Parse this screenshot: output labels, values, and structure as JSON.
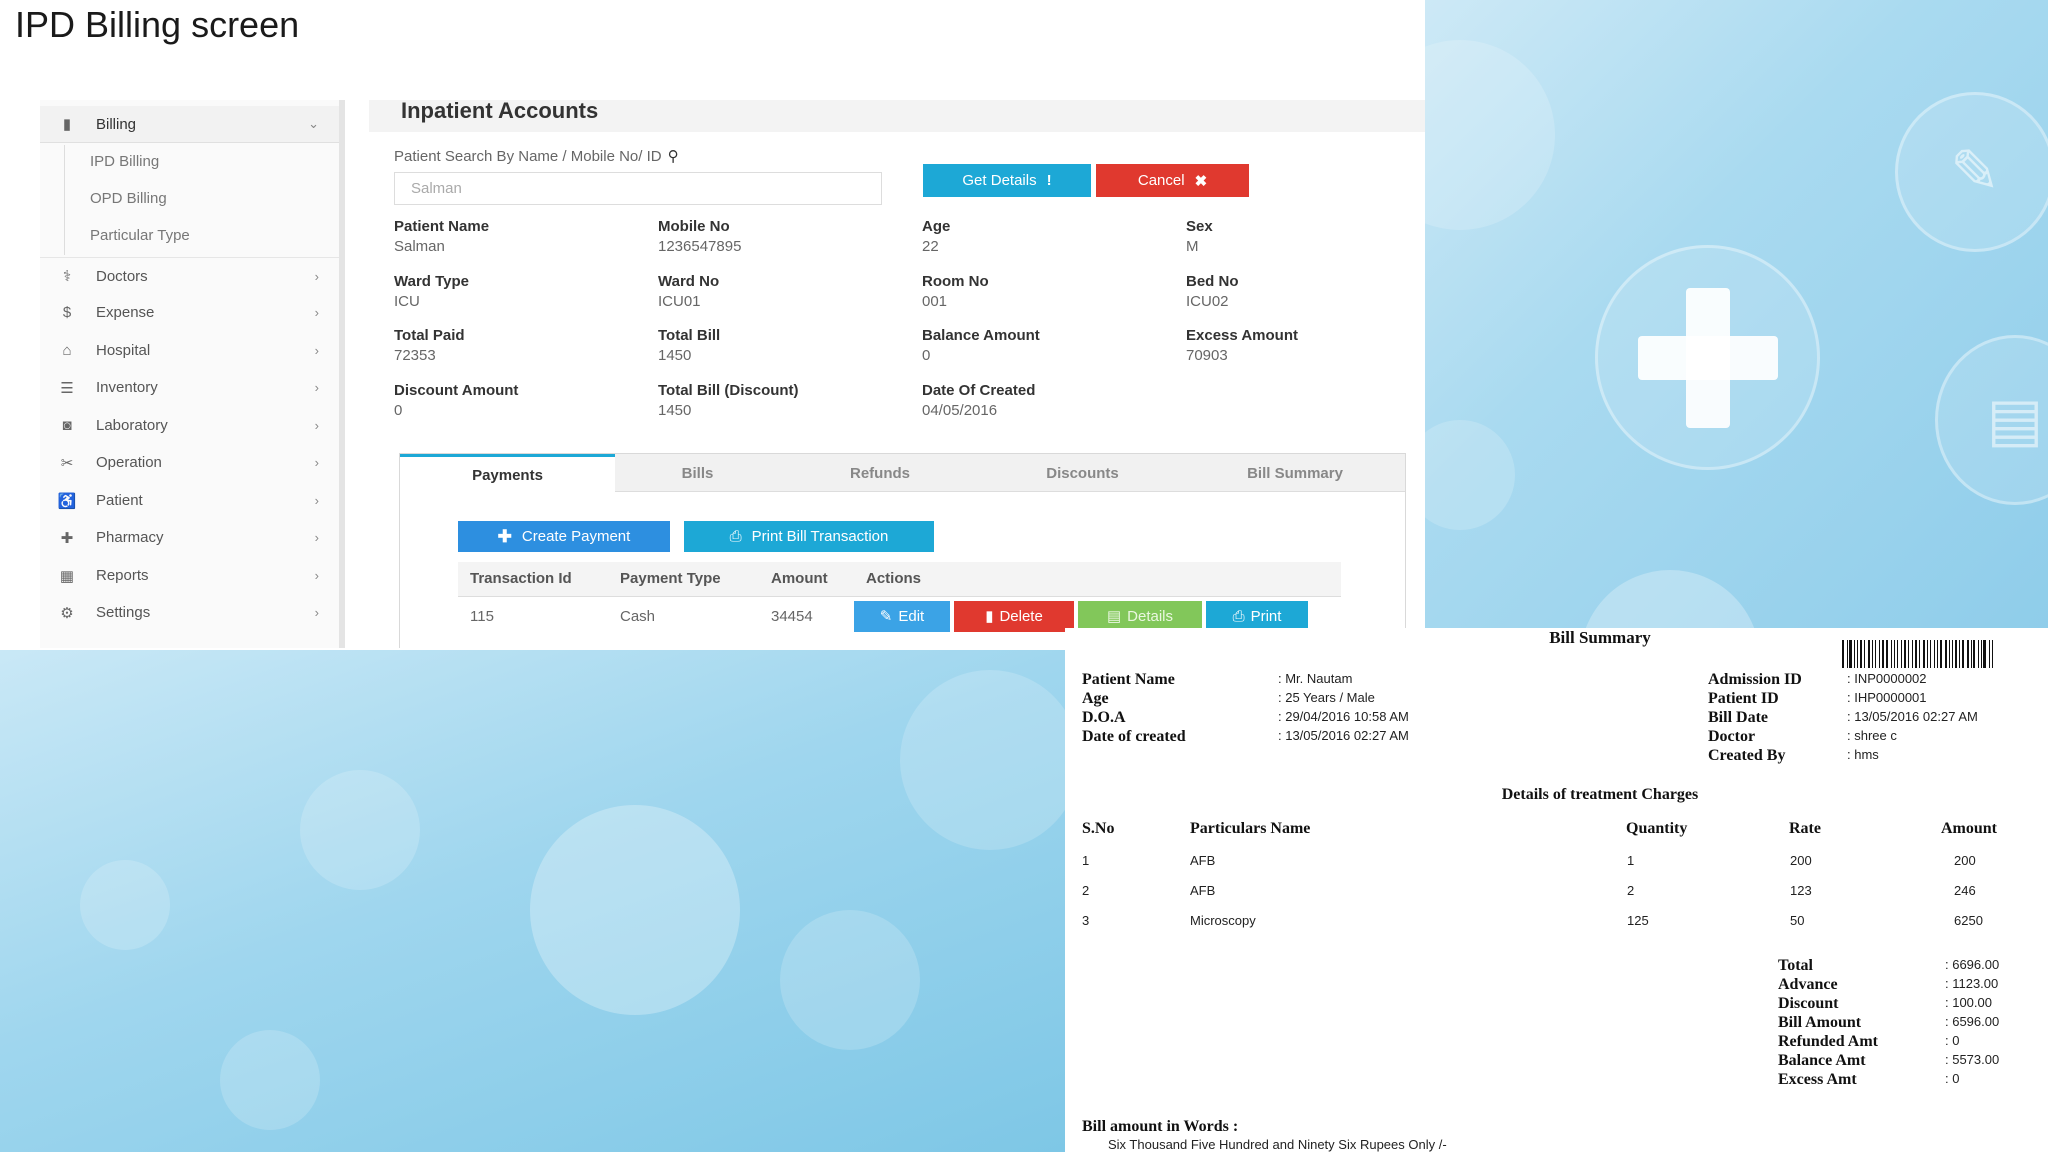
{
  "slide_title": "IPD Billing screen",
  "sidebar": {
    "items": [
      {
        "icon": "billing-icon",
        "label": "Billing"
      },
      {
        "icon": "doctor-icon",
        "label": "Doctors"
      },
      {
        "icon": "dollar-icon",
        "label": "Expense"
      },
      {
        "icon": "hospital-icon",
        "label": "Hospital"
      },
      {
        "icon": "inventory-icon",
        "label": "Inventory"
      },
      {
        "icon": "laboratory-icon",
        "label": "Laboratory"
      },
      {
        "icon": "operation-icon",
        "label": "Operation"
      },
      {
        "icon": "patient-icon",
        "label": "Patient"
      },
      {
        "icon": "plus-icon",
        "label": "Pharmacy"
      },
      {
        "icon": "reports-icon",
        "label": "Reports"
      },
      {
        "icon": "gear-icon",
        "label": "Settings"
      }
    ],
    "billing_sub": [
      "IPD Billing",
      "OPD Billing",
      "Particular Type"
    ]
  },
  "main": {
    "title": "Inpatient Accounts",
    "search_label": "Patient Search By Name / Mobile No/ ID",
    "search_value": "Salman",
    "get_details_label": "Get Details",
    "cancel_label": "Cancel",
    "fields": [
      {
        "label": "Patient Name",
        "value": "Salman"
      },
      {
        "label": "Mobile No",
        "value": "1236547895"
      },
      {
        "label": "Age",
        "value": "22"
      },
      {
        "label": "Sex",
        "value": "M"
      },
      {
        "label": "Ward Type",
        "value": "ICU"
      },
      {
        "label": "Ward No",
        "value": "ICU01"
      },
      {
        "label": "Room No",
        "value": "001"
      },
      {
        "label": "Bed No",
        "value": "ICU02"
      },
      {
        "label": "Total Paid",
        "value": "72353"
      },
      {
        "label": "Total Bill",
        "value": "1450"
      },
      {
        "label": "Balance Amount",
        "value": "0"
      },
      {
        "label": "Excess Amount",
        "value": "70903"
      },
      {
        "label": "Discount Amount",
        "value": "0"
      },
      {
        "label": "Total Bill (Discount)",
        "value": "1450"
      },
      {
        "label": "Date Of Created",
        "value": "04/05/2016"
      }
    ],
    "tabs": [
      "Payments",
      "Bills",
      "Refunds",
      "Discounts",
      "Bill Summary"
    ],
    "create_payment_label": "Create Payment",
    "print_bill_label": "Print Bill Transaction",
    "table": {
      "headers": [
        "Transaction Id",
        "Payment Type",
        "Amount",
        "Actions"
      ],
      "rows": [
        {
          "id": "115",
          "type": "Cash",
          "amount": "34454"
        }
      ],
      "actions": [
        "Edit",
        "Delete",
        "Details",
        "Print"
      ]
    }
  },
  "bill": {
    "title": "Bill Summary",
    "left": [
      {
        "label": "Patient Name",
        "value": ": Mr. Nautam"
      },
      {
        "label": "Age",
        "value": ": 25 Years / Male"
      },
      {
        "label": "D.O.A",
        "value": ": 29/04/2016 10:58 AM"
      },
      {
        "label": "Date of created",
        "value": ": 13/05/2016 02:27 AM"
      }
    ],
    "right": [
      {
        "label": "Admission ID",
        "value": ": INP0000002"
      },
      {
        "label": "Patient ID",
        "value": ": IHP0000001"
      },
      {
        "label": "Bill Date",
        "value": ": 13/05/2016 02:27 AM"
      },
      {
        "label": "Doctor",
        "value": ": shree c"
      },
      {
        "label": "Created By",
        "value": ": hms"
      }
    ],
    "charges_title": "Details of treatment Charges",
    "charges_headers": [
      "S.No",
      "Particulars Name",
      "Quantity",
      "Rate",
      "Amount"
    ],
    "charges": [
      [
        "1",
        "AFB",
        "1",
        "200",
        "200"
      ],
      [
        "2",
        "AFB",
        "2",
        "123",
        "246"
      ],
      [
        "3",
        "Microscopy",
        "125",
        "50",
        "6250"
      ]
    ],
    "totals": [
      {
        "label": "Total",
        "value": ": 6696.00"
      },
      {
        "label": "Advance",
        "value": ": 1123.00"
      },
      {
        "label": "Discount",
        "value": ": 100.00"
      },
      {
        "label": "Bill Amount",
        "value": ": 6596.00"
      },
      {
        "label": "Refunded Amt",
        "value": ": 0"
      },
      {
        "label": "Balance Amt",
        "value": ": 5573.00"
      },
      {
        "label": "Excess Amt",
        "value": ": 0"
      }
    ],
    "words_label": "Bill amount in Words :",
    "words_value": "Six Thousand Five Hundred and Ninety Six Rupees Only /-"
  }
}
